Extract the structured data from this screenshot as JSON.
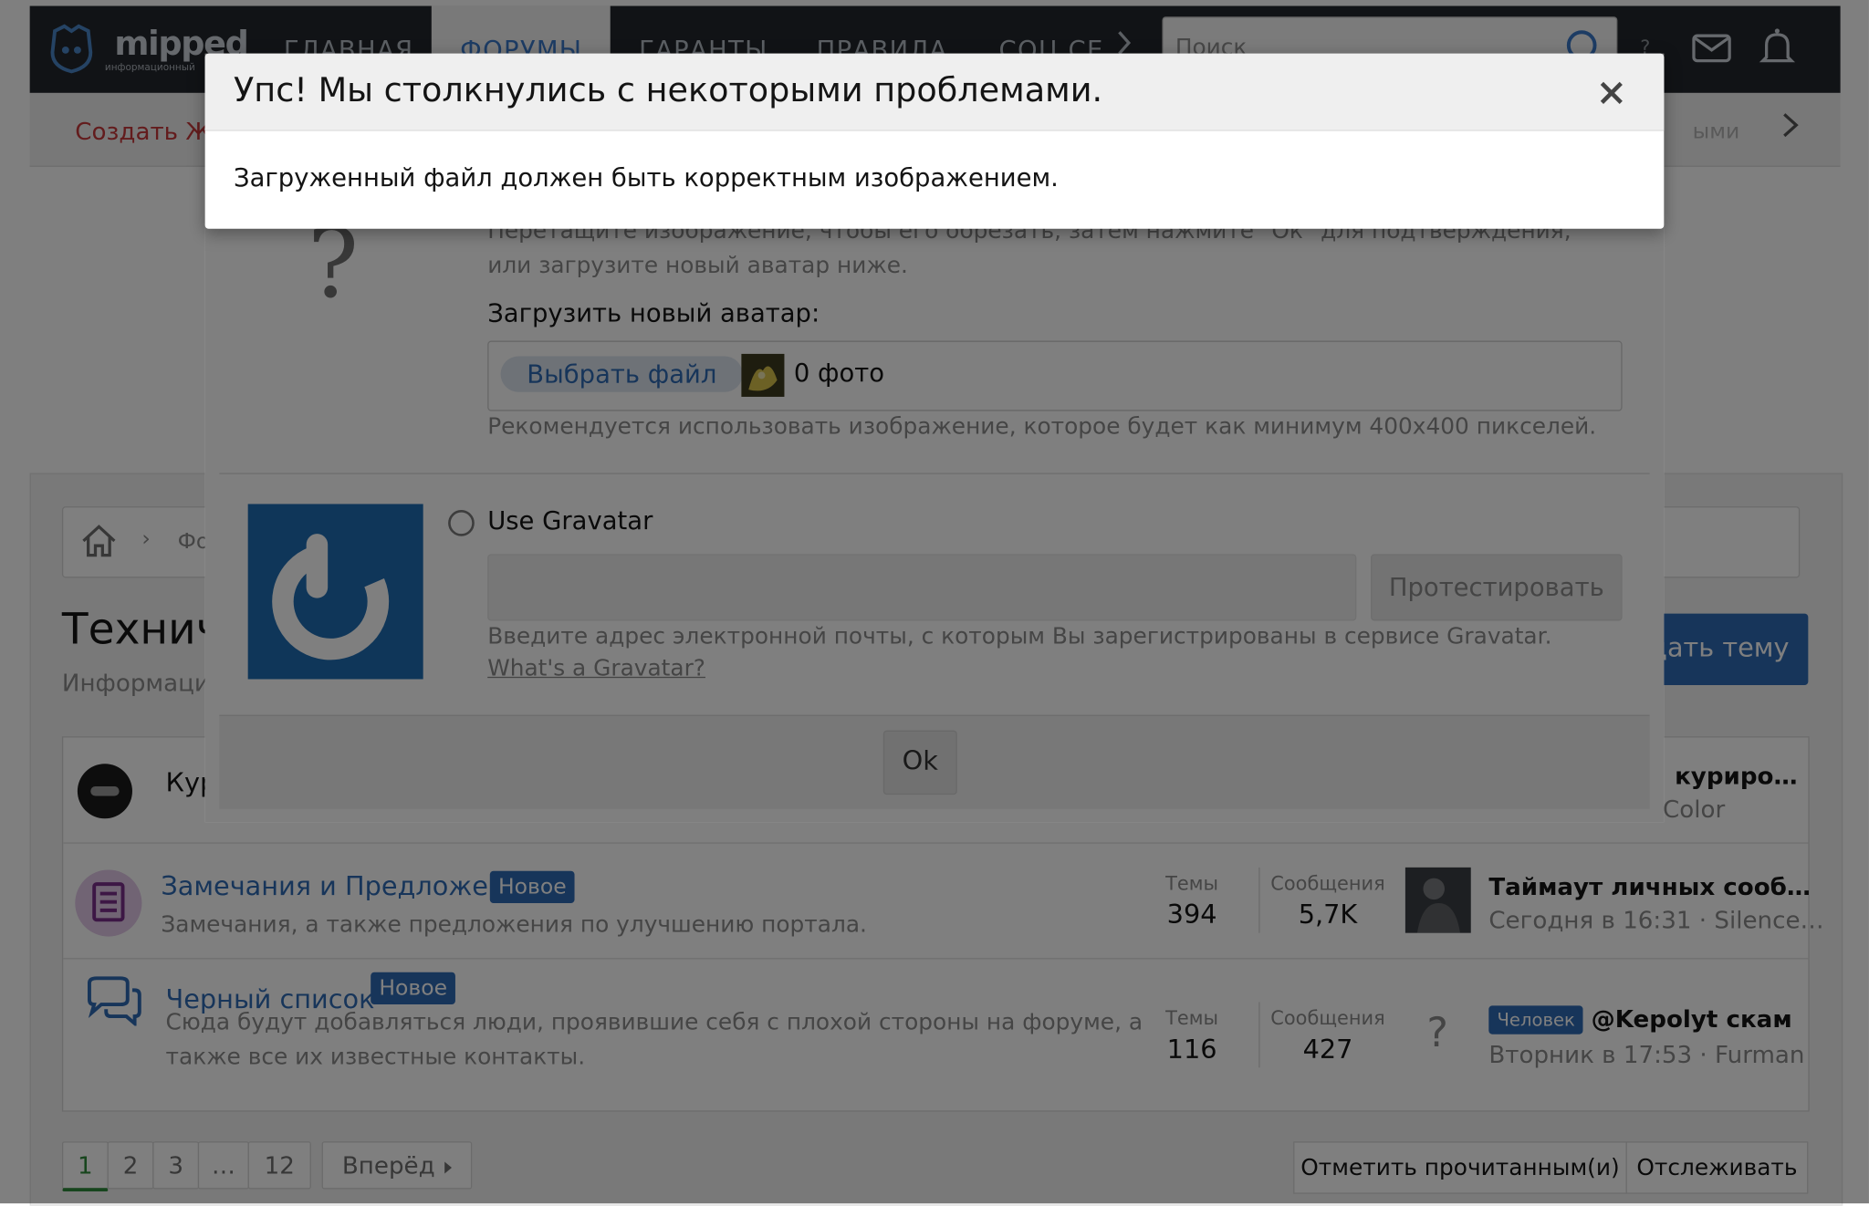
{
  "header": {
    "logo_text": "mipped",
    "logo_sub": "информационный",
    "nav": [
      "ГЛАВНАЯ",
      "ФОРУМЫ",
      "ГАРАНТЫ",
      "ПРАВИЛА",
      "СОЦ СЕ"
    ],
    "search_placeholder": "Поиск",
    "question_mark": "?"
  },
  "subnav": {
    "create_link": "Создать Ж",
    "faded_text": "ыми"
  },
  "breadcrumb": {
    "crumb": "Фо"
  },
  "forum": {
    "title": "Технич",
    "description": "Информация",
    "create_thread": "дать тему"
  },
  "rows": [
    {
      "title": "Кур",
      "last_title": "курирo…",
      "last_meta": "Color"
    },
    {
      "title": "Замечания и Предложения",
      "badge": "Новое",
      "description": "Замечания, а также предложения по улучшению портала.",
      "threads_label": "Темы",
      "threads": "394",
      "messages_label": "Сообщения",
      "messages": "5,7K",
      "last_title": "Таймаут личных сооб…",
      "last_meta": "Сегодня в 16:31 · Silence…"
    },
    {
      "title": "Черный список",
      "badge": "Новое",
      "description": "Сюда будут добавляться люди, проявившие себя с плохой стороны на форуме, а также все их известные контакты.",
      "threads_label": "Темы",
      "threads": "116",
      "messages_label": "Сообщения",
      "messages": "427",
      "last_avatar": "?",
      "last_prefix": "Человек",
      "last_title": "@Kepolyt скам",
      "last_meta": "Вторник в 17:53 · Furman"
    }
  ],
  "pagination": {
    "pages": [
      "1",
      "2",
      "3",
      "…",
      "12"
    ],
    "current": "1",
    "next": "Вперёд"
  },
  "tools": {
    "mark_read": "Отметить прочитанным(и)",
    "watch": "Отслеживать"
  },
  "avatar_dialog": {
    "placeholder_avatar": "?",
    "hint": "Перетащите изображение, чтобы его обрезать, затем нажмите \"Ок\" для подтверждения, или загрузите новый аватар ниже.",
    "upload_label": "Загрузить новый аватар:",
    "choose_file": "Выбрать файл",
    "file_count": "0 фото",
    "recommend": "Рекомендуется использовать изображение, которое будет как минимум 400x400 пикселей.",
    "gravatar_label": "Use Gravatar",
    "test_button": "Протестировать",
    "gravatar_help": "Введите адрес электронной почты, с которым Вы зарегистрированы в сервисе Gravatar.",
    "gravatar_link": "What's a Gravatar?",
    "ok": "Ok"
  },
  "error_dialog": {
    "title": "Упс! Мы столкнулись с некоторыми проблемами.",
    "message": "Загруженный файл должен быть корректным изображением."
  },
  "colors": {
    "header_bg": "#23272c",
    "accent_blue": "#2f6bb5",
    "link_red": "#c7383a",
    "gravatar_blue": "#1e6cb3"
  }
}
